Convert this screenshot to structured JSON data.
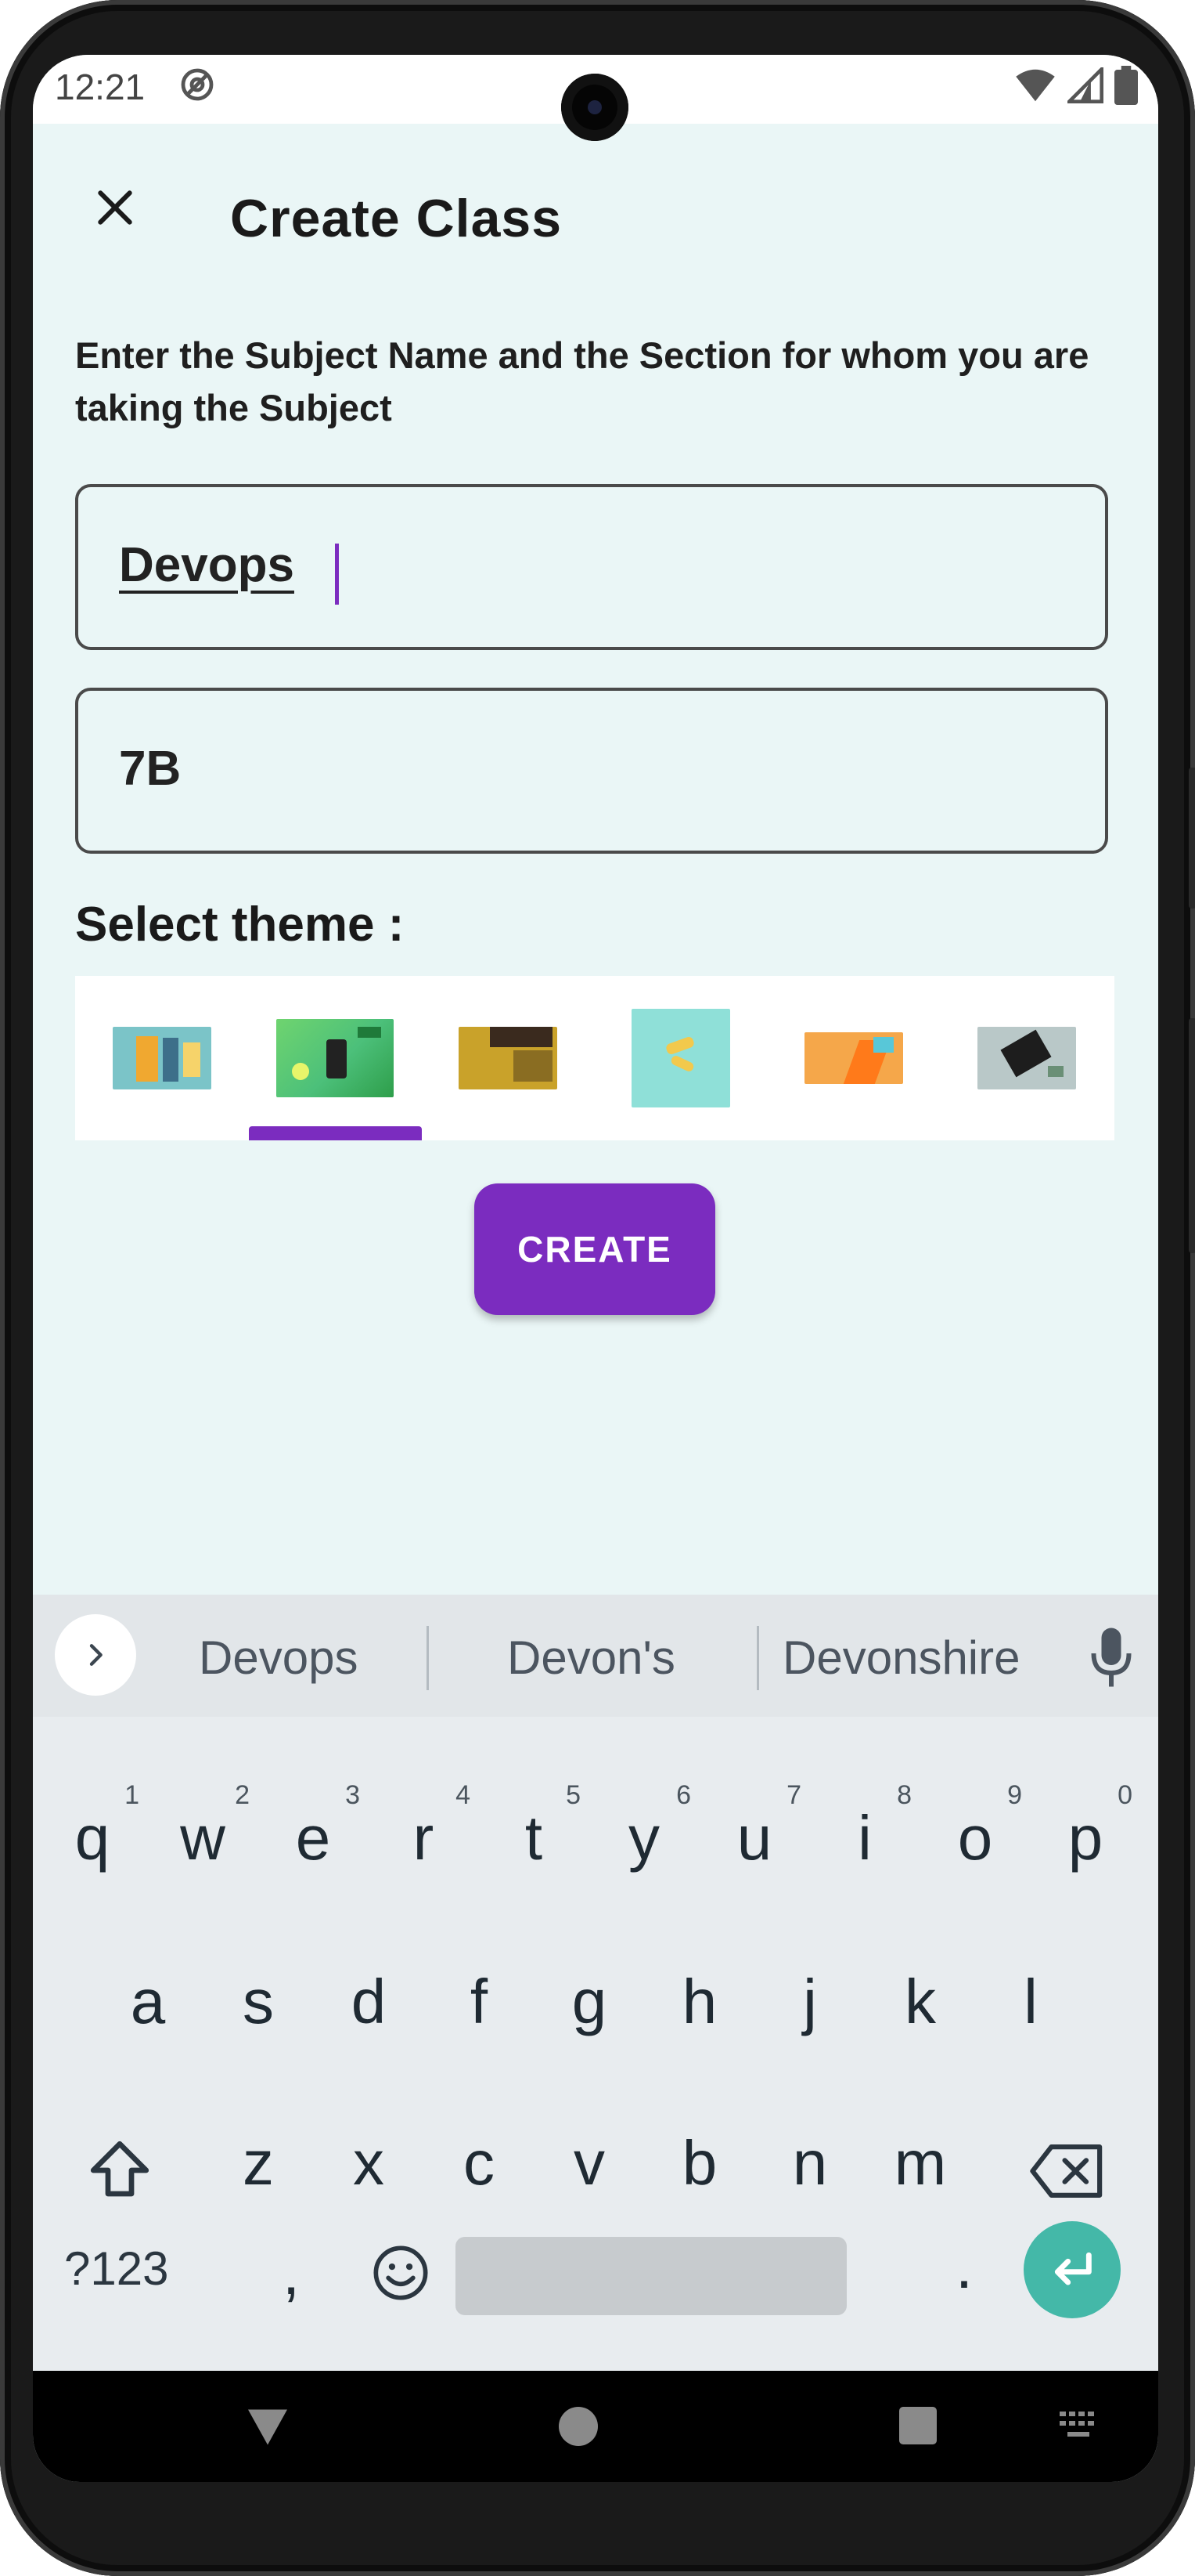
{
  "status_bar": {
    "time": "12:21"
  },
  "header": {
    "title": "Create Class"
  },
  "instruction": "Enter the Subject Name and the Section for whom you are taking the Subject",
  "subject_field": {
    "value": "Devops"
  },
  "section_field": {
    "value": "7B"
  },
  "theme_label": "Select theme :",
  "themes": [
    {
      "name": "theme-1",
      "colors": [
        "#7bc4c8",
        "#f0a830",
        "#3d6f8a"
      ]
    },
    {
      "name": "theme-2",
      "colors": [
        "#6fd46f",
        "#2e9e4a",
        "#3a3a3a"
      ],
      "selected": true
    },
    {
      "name": "theme-3",
      "colors": [
        "#c9a22a",
        "#3a2a1e",
        "#8a6d22"
      ]
    },
    {
      "name": "theme-4",
      "colors": [
        "#8fe0d8",
        "#f2c94c",
        "#b6ece6"
      ]
    },
    {
      "name": "theme-5",
      "colors": [
        "#f5a74a",
        "#ff7a1a",
        "#58c7d8"
      ]
    },
    {
      "name": "theme-6",
      "colors": [
        "#b9c8c8",
        "#1d1d1d",
        "#6a8f76"
      ]
    }
  ],
  "create_button": "CREATE",
  "keyboard": {
    "suggestions": [
      "Devops",
      "Devon's",
      "Devonshire"
    ],
    "row1": [
      {
        "k": "q",
        "n": "1"
      },
      {
        "k": "w",
        "n": "2"
      },
      {
        "k": "e",
        "n": "3"
      },
      {
        "k": "r",
        "n": "4"
      },
      {
        "k": "t",
        "n": "5"
      },
      {
        "k": "y",
        "n": "6"
      },
      {
        "k": "u",
        "n": "7"
      },
      {
        "k": "i",
        "n": "8"
      },
      {
        "k": "o",
        "n": "9"
      },
      {
        "k": "p",
        "n": "0"
      }
    ],
    "row2": [
      "a",
      "s",
      "d",
      "f",
      "g",
      "h",
      "j",
      "k",
      "l"
    ],
    "row3": [
      "z",
      "x",
      "c",
      "v",
      "b",
      "n",
      "m"
    ],
    "symbols_key": "?123",
    "comma_key": ",",
    "period_key": "."
  },
  "colors": {
    "accent": "#7b2cbf",
    "background": "#eaf6f6",
    "enter": "#44b8a8"
  }
}
